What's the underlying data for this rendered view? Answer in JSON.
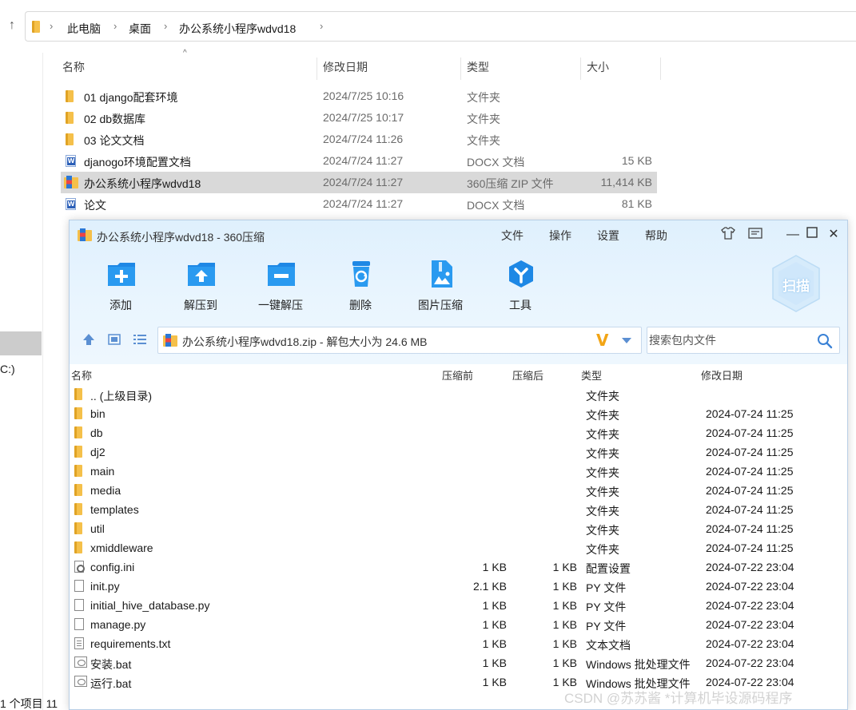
{
  "explorer": {
    "breadcrumb": [
      "此电脑",
      "桌面",
      "办公系统小程序wdvd18"
    ],
    "columns": [
      "名称",
      "修改日期",
      "类型",
      "大小"
    ],
    "rows": [
      {
        "name": "01 django配套环境",
        "date": "2024/7/25 10:16",
        "type": "文件夹",
        "size": "",
        "icon": "folder-icon"
      },
      {
        "name": "02 db数据库",
        "date": "2024/7/25 10:17",
        "type": "文件夹",
        "size": "",
        "icon": "folder-icon"
      },
      {
        "name": "03 论文文档",
        "date": "2024/7/24 11:26",
        "type": "文件夹",
        "size": "",
        "icon": "folder-icon"
      },
      {
        "name": "djanogo环境配置文档",
        "date": "2024/7/24 11:27",
        "type": "DOCX 文档",
        "size": "15 KB",
        "icon": "word-doc-icon"
      },
      {
        "name": "办公系统小程序wdvd18",
        "date": "2024/7/24 11:27",
        "type": "360压缩 ZIP 文件",
        "size": "11,414 KB",
        "icon": "zip-archive-icon"
      },
      {
        "name": "论文",
        "date": "2024/7/24 11:27",
        "type": "DOCX 文档",
        "size": "81 KB",
        "icon": "word-doc-icon"
      }
    ],
    "left_drive": "C:)",
    "status": "1 个项目  11"
  },
  "zip": {
    "title": "办公系统小程序wdvd18 - 360压缩",
    "menu": [
      "文件",
      "操作",
      "设置",
      "帮助"
    ],
    "toolbar": [
      {
        "label": "添加",
        "icon": "add-icon"
      },
      {
        "label": "解压到",
        "icon": "extract-to-icon"
      },
      {
        "label": "一键解压",
        "icon": "one-click-extract-icon"
      },
      {
        "label": "删除",
        "icon": "delete-icon"
      },
      {
        "label": "图片压缩",
        "icon": "image-compress-icon"
      },
      {
        "label": "工具",
        "icon": "tools-icon"
      }
    ],
    "scan_label": "扫描",
    "path": "办公系统小程序wdvd18.zip - 解包大小为 24.6 MB",
    "search_placeholder": "搜索包内文件",
    "columns": [
      "名称",
      "压缩前",
      "压缩后",
      "类型",
      "修改日期"
    ],
    "rows": [
      {
        "name": ".. (上级目录)",
        "before": "",
        "after": "",
        "type": "文件夹",
        "modified": "",
        "icon": "folder-icon"
      },
      {
        "name": "bin",
        "before": "",
        "after": "",
        "type": "文件夹",
        "modified": "2024-07-24 11:25",
        "icon": "folder-icon"
      },
      {
        "name": "db",
        "before": "",
        "after": "",
        "type": "文件夹",
        "modified": "2024-07-24 11:25",
        "icon": "folder-icon"
      },
      {
        "name": "dj2",
        "before": "",
        "after": "",
        "type": "文件夹",
        "modified": "2024-07-24 11:25",
        "icon": "folder-icon"
      },
      {
        "name": "main",
        "before": "",
        "after": "",
        "type": "文件夹",
        "modified": "2024-07-24 11:25",
        "icon": "folder-icon"
      },
      {
        "name": "media",
        "before": "",
        "after": "",
        "type": "文件夹",
        "modified": "2024-07-24 11:25",
        "icon": "folder-icon"
      },
      {
        "name": "templates",
        "before": "",
        "after": "",
        "type": "文件夹",
        "modified": "2024-07-24 11:25",
        "icon": "folder-icon"
      },
      {
        "name": "util",
        "before": "",
        "after": "",
        "type": "文件夹",
        "modified": "2024-07-24 11:25",
        "icon": "folder-icon"
      },
      {
        "name": "xmiddleware",
        "before": "",
        "after": "",
        "type": "文件夹",
        "modified": "2024-07-24 11:25",
        "icon": "folder-icon"
      },
      {
        "name": "config.ini",
        "before": "1 KB",
        "after": "1 KB",
        "type": "配置设置",
        "modified": "2024-07-22 23:04",
        "icon": "config-file-icon"
      },
      {
        "name": "init.py",
        "before": "2.1 KB",
        "after": "1 KB",
        "type": "PY 文件",
        "modified": "2024-07-22 23:04",
        "icon": "file-icon"
      },
      {
        "name": "initial_hive_database.py",
        "before": "1 KB",
        "after": "1 KB",
        "type": "PY 文件",
        "modified": "2024-07-22 23:04",
        "icon": "file-icon"
      },
      {
        "name": "manage.py",
        "before": "1 KB",
        "after": "1 KB",
        "type": "PY 文件",
        "modified": "2024-07-22 23:04",
        "icon": "file-icon"
      },
      {
        "name": "requirements.txt",
        "before": "1 KB",
        "after": "1 KB",
        "type": "文本文档",
        "modified": "2024-07-22 23:04",
        "icon": "text-file-icon"
      },
      {
        "name": "安装.bat",
        "before": "1 KB",
        "after": "1 KB",
        "type": "Windows 批处理文件",
        "modified": "2024-07-22 23:04",
        "icon": "batch-file-icon"
      },
      {
        "name": "运行.bat",
        "before": "1 KB",
        "after": "1 KB",
        "type": "Windows 批处理文件",
        "modified": "2024-07-22 23:04",
        "icon": "batch-file-icon"
      }
    ]
  },
  "watermark": "CSDN @苏苏酱   *计算机毕设源码程序",
  "colors": {
    "accent": "#2a8be6",
    "zip_header_bg": "#e3f2fd",
    "selection": "#d9d9d9",
    "v_logo": "#f2a516"
  }
}
